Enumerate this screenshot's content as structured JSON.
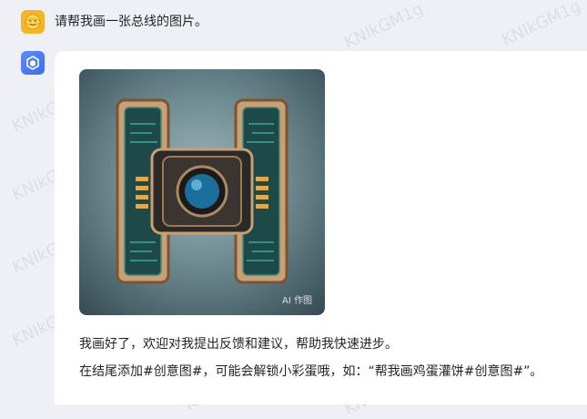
{
  "user": {
    "avatar_icon": "smiley-face-icon",
    "message": "请帮我画一张总线的图片。"
  },
  "bot": {
    "avatar_icon": "cube-logo-icon",
    "image_badge": "AI 作图",
    "reply_line1": "我画好了，欢迎对我提出反馈和建议，帮助我快速进步。",
    "reply_line2": "在结尾添加#创意图#，可能会解锁小彩蛋哦，如：“帮我画鸡蛋灌饼#创意图#”。"
  },
  "watermark": {
    "text": "KNIkGM1g"
  },
  "colors": {
    "background": "#eef0f6",
    "card": "#ffffff",
    "user_avatar": "#f4b625",
    "bot_avatar": "#4a7cf6"
  }
}
